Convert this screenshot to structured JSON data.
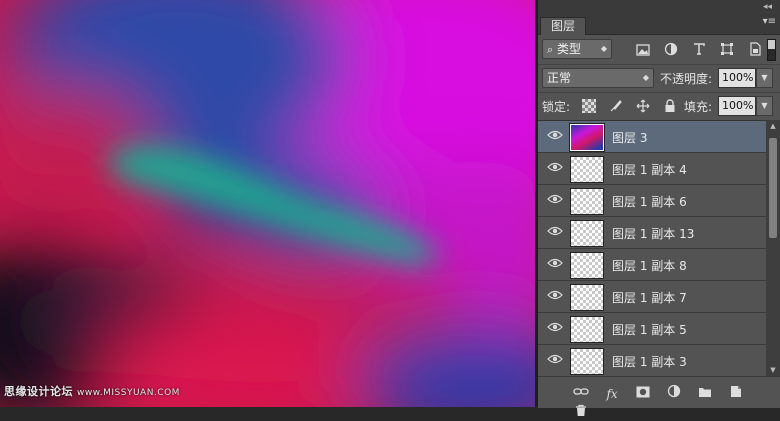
{
  "canvas": {
    "watermark": "思缘设计论坛",
    "watermark_url": "www.MISSYUAN.COM"
  },
  "panel": {
    "collapse_glyph": "◂◂",
    "menu_glyph": "▾≡",
    "tab_label": "图层",
    "filter": {
      "search_glyph": "⌕",
      "kind_label": "类型",
      "icons": [
        "image-filter-icon",
        "adjustment-filter-icon",
        "type-filter-icon",
        "shape-filter-icon",
        "smart-object-filter-icon"
      ]
    },
    "blend_mode": "正常",
    "opacity_label": "不透明度:",
    "opacity_value": "100%",
    "lock_label": "锁定:",
    "fill_label": "填充:",
    "fill_value": "100%",
    "layers": [
      {
        "name": "图层 3",
        "selected": true,
        "thumb": "image"
      },
      {
        "name": "图层 1 副本 4",
        "selected": false,
        "thumb": "transparent"
      },
      {
        "name": "图层 1 副本 6",
        "selected": false,
        "thumb": "transparent"
      },
      {
        "name": "图层 1 副本 13",
        "selected": false,
        "thumb": "transparent"
      },
      {
        "name": "图层 1 副本 8",
        "selected": false,
        "thumb": "transparent"
      },
      {
        "name": "图层 1 副本 7",
        "selected": false,
        "thumb": "transparent"
      },
      {
        "name": "图层 1 副本 5",
        "selected": false,
        "thumb": "transparent"
      },
      {
        "name": "图层 1 副本 3",
        "selected": false,
        "thumb": "transparent"
      }
    ],
    "bottom_icons": [
      "link-layers-icon",
      "fx-icon",
      "add-mask-icon",
      "adjustment-layer-icon",
      "new-group-icon",
      "new-layer-icon",
      "delete-layer-icon"
    ]
  }
}
